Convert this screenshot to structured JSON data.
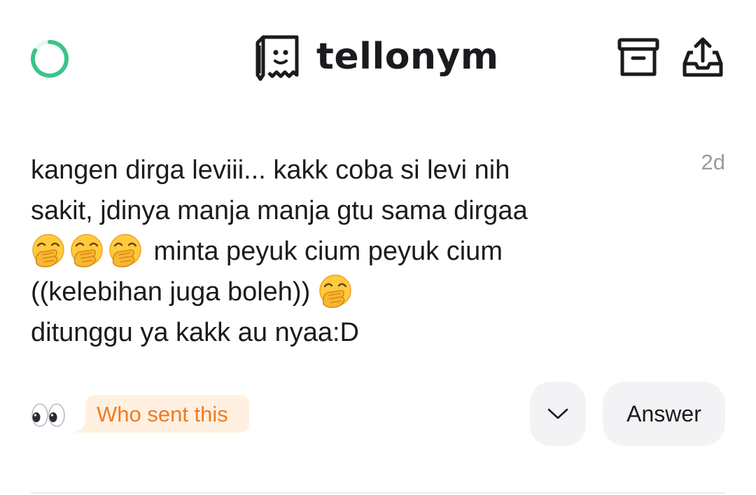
{
  "header": {
    "brand_name": "tellonym",
    "progress_color": "#3ac48a"
  },
  "tell": {
    "timestamp": "2d",
    "lines": [
      [
        {
          "text": "kangen dirga leviii... kakk coba si levi nih"
        }
      ],
      [
        {
          "text": "sakit, jdinya manja manja gtu sama dirgaa"
        }
      ],
      [
        {
          "emoji": "hand-over-mouth"
        },
        {
          "emoji": "hand-over-mouth"
        },
        {
          "emoji": "hand-over-mouth"
        },
        {
          "text": " minta peyuk cium peyuk cium"
        }
      ],
      [
        {
          "text": "((kelebihan juga boleh)) "
        },
        {
          "emoji": "hand-over-mouth"
        }
      ],
      [
        {
          "text": "ditunggu ya kakk au nyaa:D"
        }
      ]
    ]
  },
  "actions": {
    "eyes_icon": "eyes-emoji",
    "who_sent_label": "Who sent this",
    "who_sent_color": "#ef7b22",
    "who_sent_bg": "#fff0e2",
    "answer_label": "Answer"
  }
}
